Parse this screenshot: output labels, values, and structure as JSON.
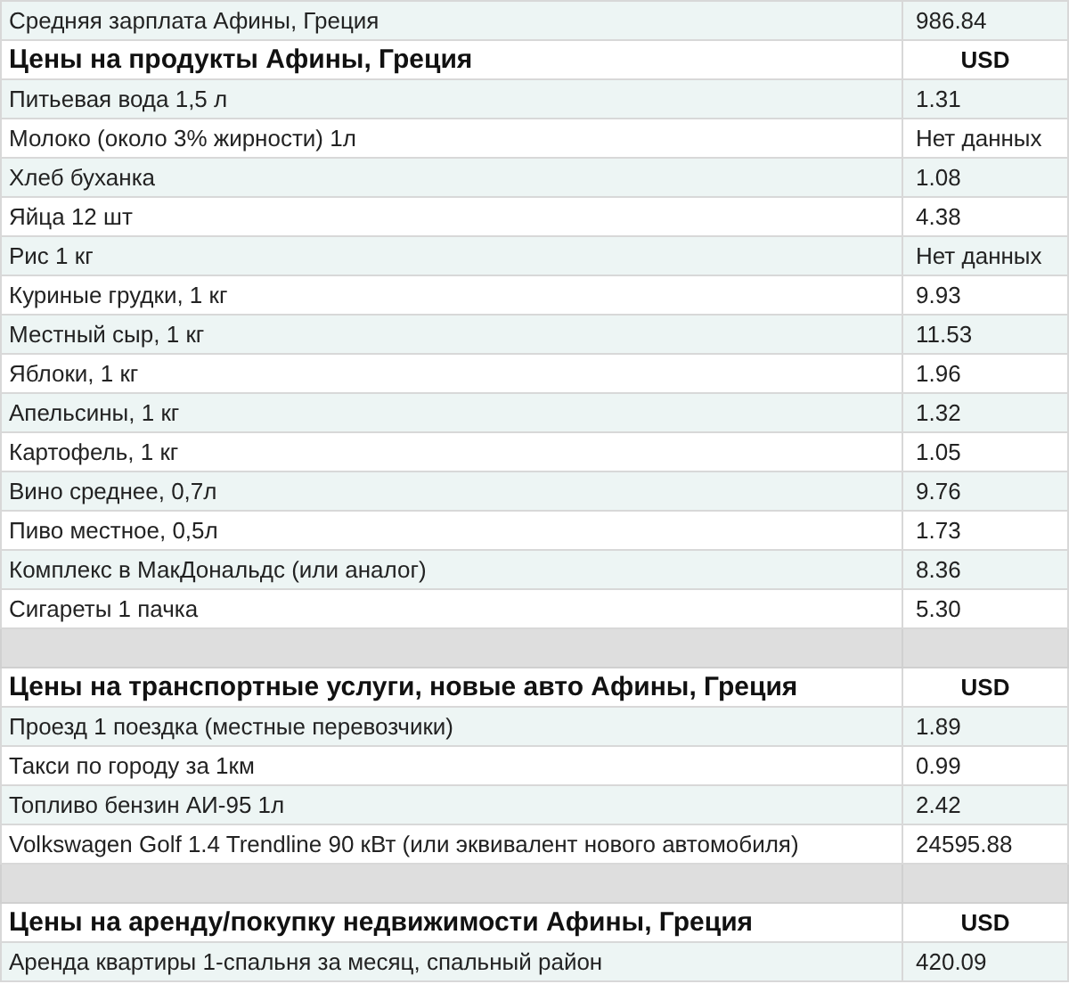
{
  "rows": [
    {
      "kind": "item",
      "label": "Средняя зарплата Афины, Греция",
      "value": "986.84"
    },
    {
      "kind": "header",
      "label": "Цены на продукты Афины, Греция",
      "value": "USD"
    },
    {
      "kind": "item",
      "label": "Питьевая вода 1,5 л",
      "value": "1.31"
    },
    {
      "kind": "item",
      "label": "Молоко (около 3% жирности) 1л",
      "value": "Нет данных"
    },
    {
      "kind": "item",
      "label": "Хлеб буханка",
      "value": "1.08"
    },
    {
      "kind": "item",
      "label": "Яйца 12 шт",
      "value": "4.38"
    },
    {
      "kind": "item",
      "label": "Рис 1 кг",
      "value": "Нет данных"
    },
    {
      "kind": "item",
      "label": "Куриные грудки, 1 кг",
      "value": "9.93"
    },
    {
      "kind": "item",
      "label": "Местный сыр, 1 кг",
      "value": "11.53"
    },
    {
      "kind": "item",
      "label": "Яблоки, 1 кг",
      "value": "1.96"
    },
    {
      "kind": "item",
      "label": "Апельсины, 1 кг",
      "value": "1.32"
    },
    {
      "kind": "item",
      "label": "Картофель, 1 кг",
      "value": "1.05"
    },
    {
      "kind": "item",
      "label": "Вино среднее, 0,7л",
      "value": "9.76"
    },
    {
      "kind": "item",
      "label": "Пиво местное, 0,5л",
      "value": "1.73"
    },
    {
      "kind": "item",
      "label": "Комплекс в МакДональдс (или аналог)",
      "value": "8.36"
    },
    {
      "kind": "item",
      "label": "Сигареты 1 пачка",
      "value": "5.30"
    },
    {
      "kind": "spacer"
    },
    {
      "kind": "header",
      "label": "Цены на транспортные услуги, новые авто Афины, Греция",
      "value": "USD"
    },
    {
      "kind": "item",
      "label": "Проезд 1 поездка (местные перевозчики)",
      "value": "1.89"
    },
    {
      "kind": "item",
      "label": "Такси по городу за 1км",
      "value": "0.99"
    },
    {
      "kind": "item",
      "label": "Топливо бензин АИ-95 1л",
      "value": "2.42"
    },
    {
      "kind": "item",
      "label": "Volkswagen Golf 1.4 Trendline 90 кВт (или эквивалент нового автомобиля)",
      "value": "24595.88"
    },
    {
      "kind": "spacer"
    },
    {
      "kind": "header",
      "label": "Цены на аренду/покупку недвижимости Афины, Греция",
      "value": "USD"
    },
    {
      "kind": "item",
      "label": "Аренда квартиры 1-спальня за месяц, спальный район",
      "value": "420.09"
    }
  ]
}
